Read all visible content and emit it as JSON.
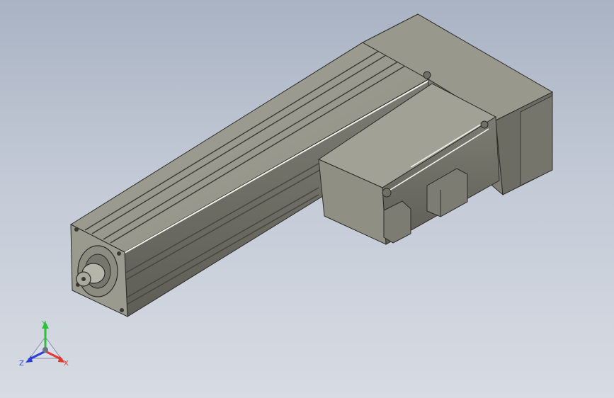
{
  "viewport": {
    "background_top": "#a9b3c3",
    "background_bottom": "#d7dbe3",
    "model_color": "#8a8a80",
    "model_dark": "#5f5f58",
    "model_light": "#b9b9ae"
  },
  "triad": {
    "x_label": "X",
    "y_label": "Y",
    "z_label": "Z",
    "x_color": "#e23a2e",
    "y_color": "#2fbf3a",
    "z_color": "#2a3fd6"
  }
}
